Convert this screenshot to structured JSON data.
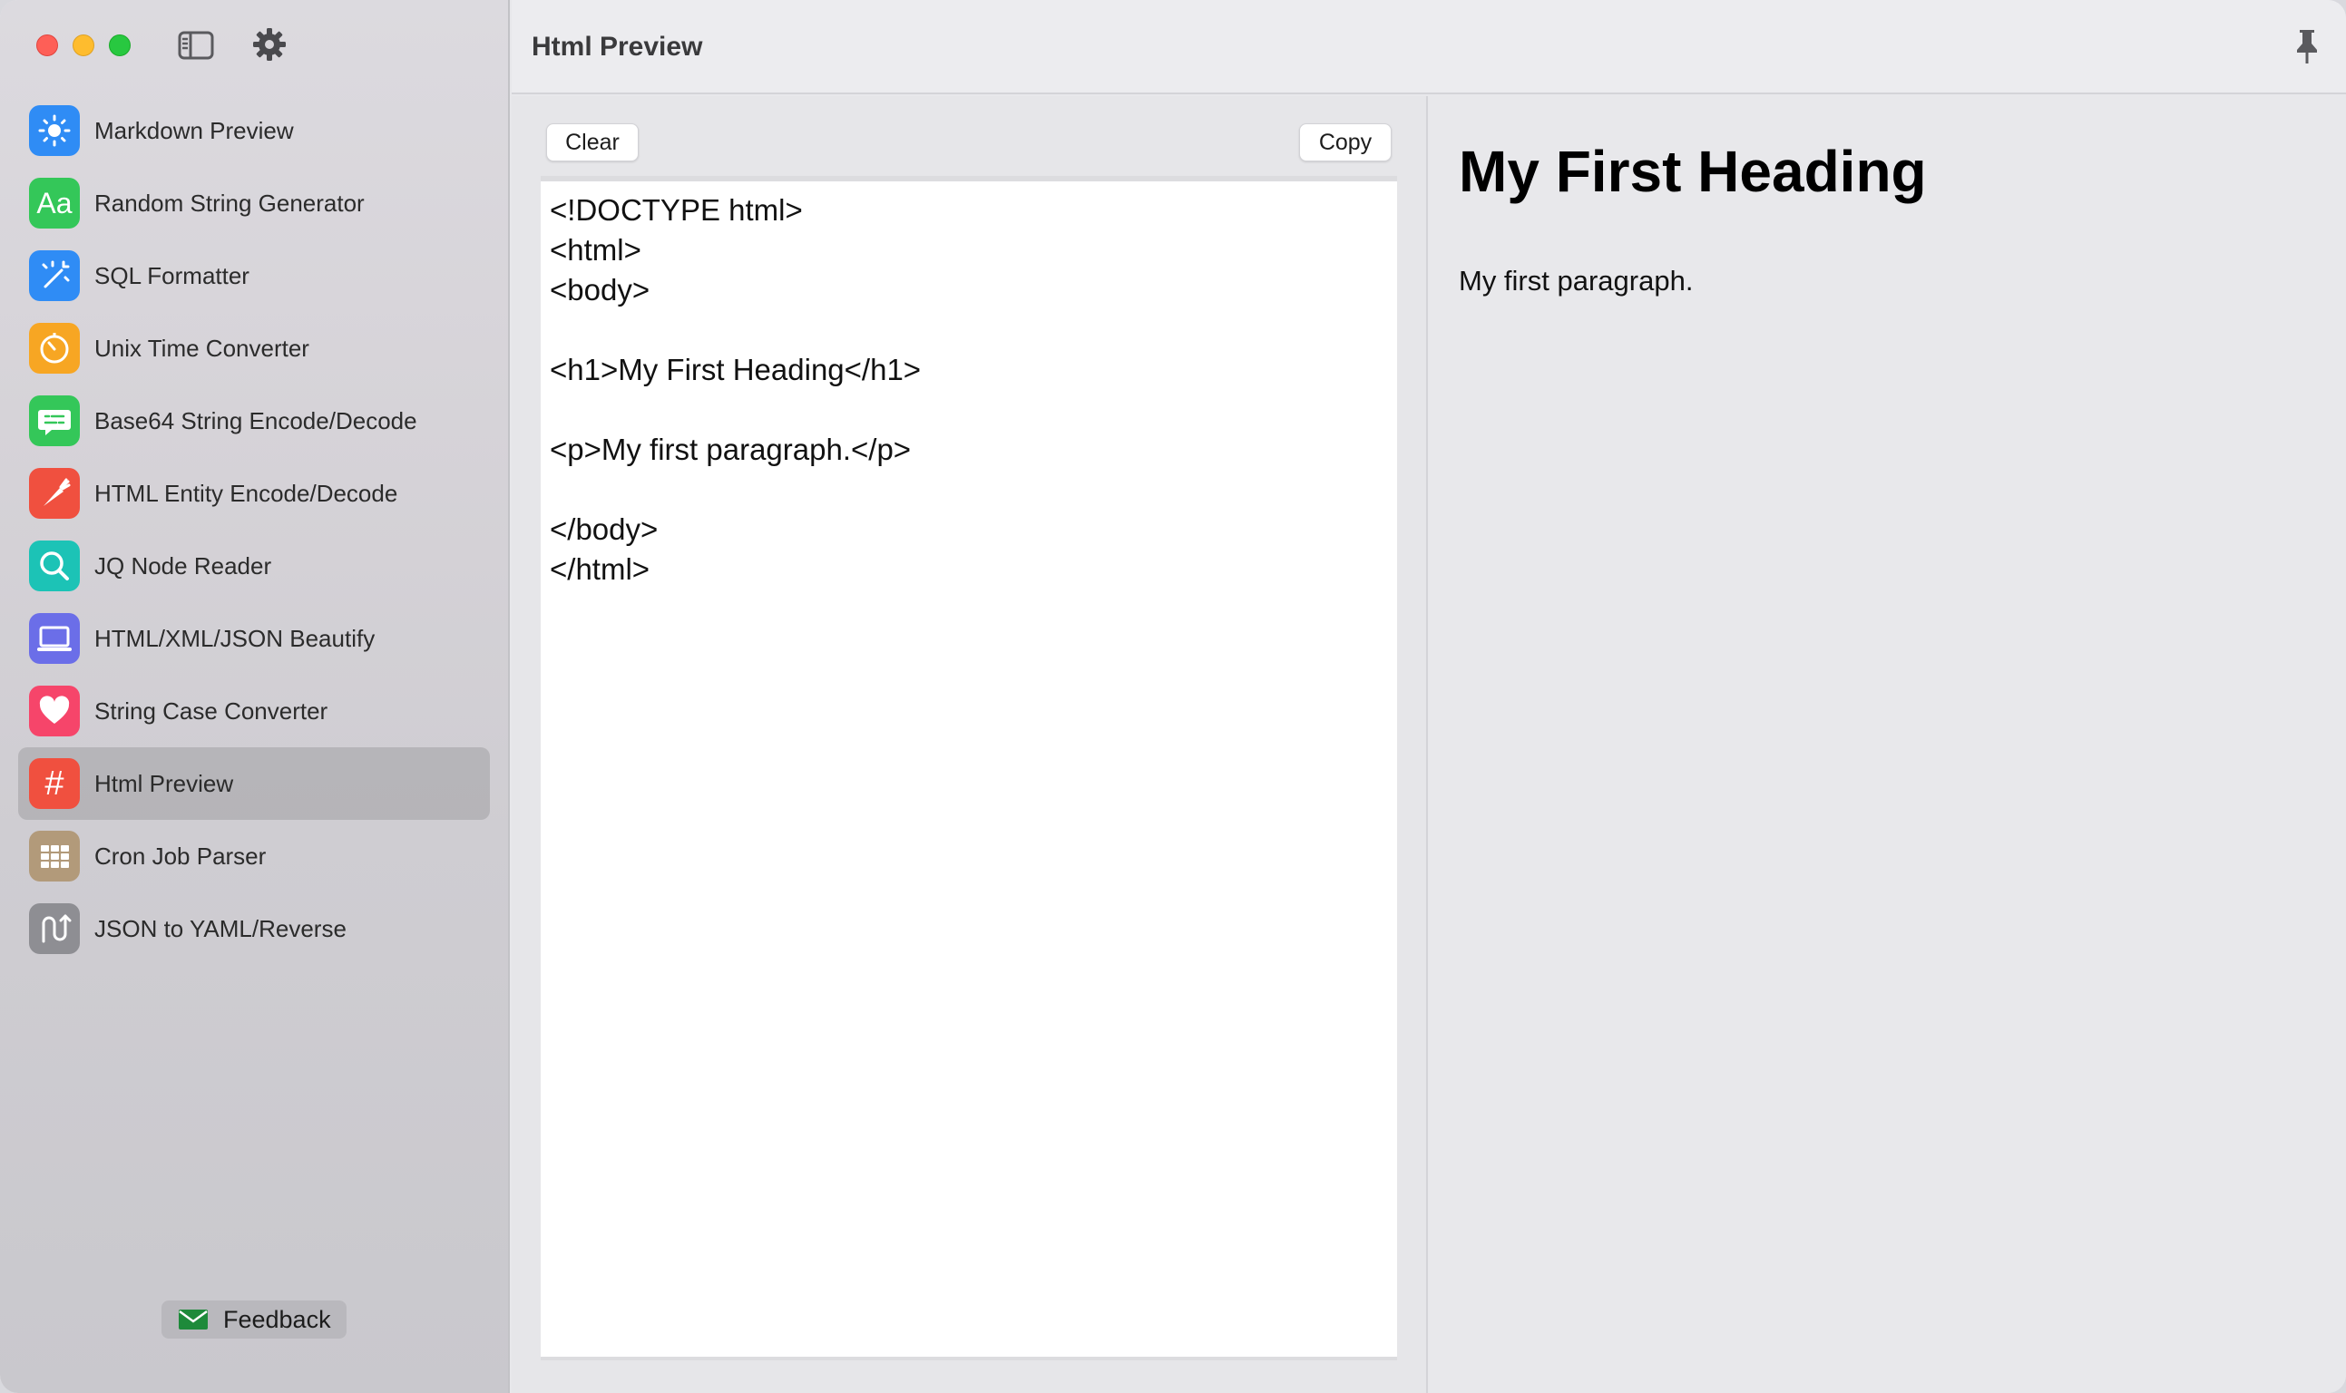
{
  "window": {
    "colors": {
      "close": "#fe5f57",
      "minimize": "#febc2e",
      "zoom": "#28c840"
    }
  },
  "sidebar": {
    "items": [
      {
        "label": "Markdown Preview",
        "icon": "sun-icon",
        "color": "#2f8cf5"
      },
      {
        "label": "Random String Generator",
        "icon": "text-aa-icon",
        "color": "#34c759"
      },
      {
        "label": "SQL Formatter",
        "icon": "magic-wand-icon",
        "color": "#2f8cf5"
      },
      {
        "label": "Unix Time Converter",
        "icon": "timer-icon",
        "color": "#f7a623"
      },
      {
        "label": "Base64 String Encode/Decode",
        "icon": "message-icon",
        "color": "#34c759"
      },
      {
        "label": "HTML Entity Encode/Decode",
        "icon": "carrot-icon",
        "color": "#f0503f"
      },
      {
        "label": "JQ Node Reader",
        "icon": "magnifier-icon",
        "color": "#1cc3b6"
      },
      {
        "label": "HTML/XML/JSON Beautify",
        "icon": "laptop-icon",
        "color": "#6b6ee8"
      },
      {
        "label": "String Case Converter",
        "icon": "heart-icon",
        "color": "#f6456a"
      },
      {
        "label": "Html Preview",
        "icon": "hashtag-icon",
        "color": "#f0503f",
        "active": true
      },
      {
        "label": "Cron Job Parser",
        "icon": "grid-icon",
        "color": "#b29a7a"
      },
      {
        "label": "JSON to YAML/Reverse",
        "icon": "swap-arrows-icon",
        "color": "#8e8e93"
      }
    ],
    "feedback_label": "Feedback"
  },
  "header": {
    "title": "Html Preview"
  },
  "editor": {
    "clear_label": "Clear",
    "copy_label": "Copy",
    "lines": [
      "<!DOCTYPE html>",
      "<html>",
      "<body>",
      "",
      "<h1>My First Heading</h1>",
      "",
      "<p>My first paragraph.</p>",
      "",
      "</body>",
      "</html>"
    ]
  },
  "preview": {
    "heading": "My First Heading",
    "paragraph": "My first paragraph."
  }
}
